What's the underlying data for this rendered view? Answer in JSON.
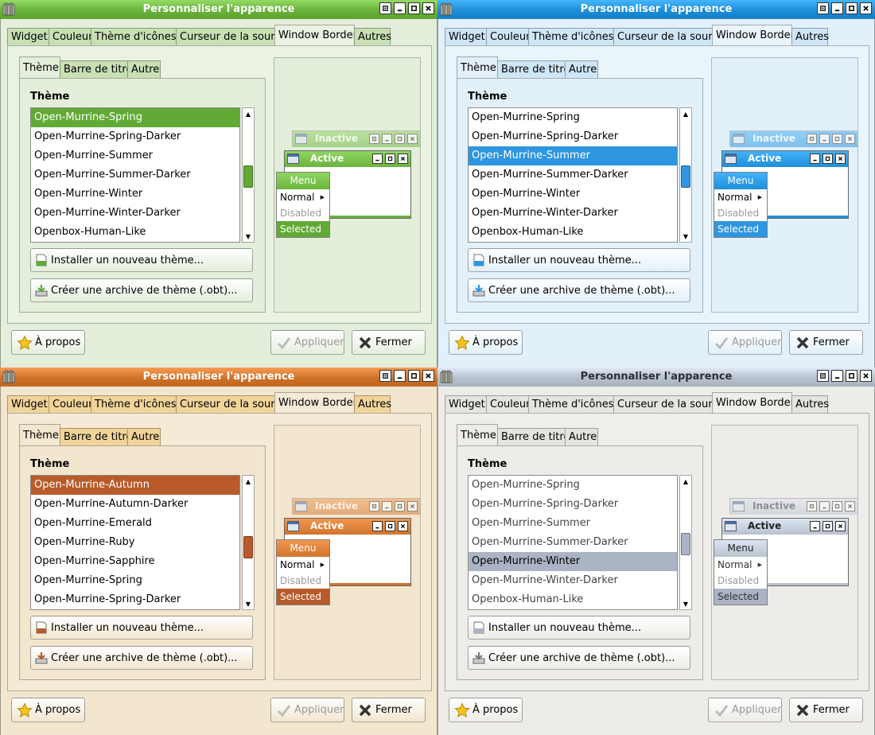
{
  "dialog": {
    "title": "Personnaliser l'apparence",
    "tabs": [
      "Widget",
      "Couleur",
      "Thème d'icônes",
      "Curseur de la souris",
      "Window Border",
      "Autres"
    ],
    "selected_tab": "Window Border",
    "inner_tabs": [
      "Thème",
      "Barre de titre",
      "Autre"
    ],
    "section_label": "Thème",
    "install_button": "Installer un nouveau thème...",
    "archive_button": "Créer une archive de thème (.obt)...",
    "about_button": "À propos",
    "apply_button": "Appliquer",
    "close_button": "Fermer"
  },
  "preview": {
    "inactive_title": "Inactive",
    "active_title": "Active",
    "menu_title": "Menu",
    "menu_items": [
      "Normal",
      "Disabled",
      "Selected"
    ]
  },
  "icons": [
    "app-icon",
    "minimize-icon",
    "maximize-icon",
    "restore-icon",
    "close-icon",
    "install-icon",
    "archive-icon",
    "star-icon",
    "check-icon",
    "x-icon"
  ],
  "windows": [
    {
      "theme": "green",
      "colors": {
        "titlebar": "#6cb33e",
        "bg": "#e3eedb",
        "tab": "#c8e0b4",
        "accent": "#62aa36",
        "panel": "#eaf2e2"
      },
      "list_items": [
        "Open-Murrine-Spring",
        "Open-Murrine-Spring-Darker",
        "Open-Murrine-Summer",
        "Open-Murrine-Summer-Darker",
        "Open-Murrine-Winter",
        "Open-Murrine-Winter-Darker",
        "Openbox-Human-Like"
      ],
      "selected_item": "Open-Murrine-Spring",
      "scroll_position": 0.52
    },
    {
      "theme": "blue",
      "colors": {
        "titlebar": "#1e8fd8",
        "bg": "#e2f0fa",
        "tab": "#cfe6f7",
        "accent": "#2e96e0",
        "panel": "#eaf4fb"
      },
      "list_items": [
        "Open-Murrine-Spring",
        "Open-Murrine-Spring-Darker",
        "Open-Murrine-Summer",
        "Open-Murrine-Summer-Darker",
        "Open-Murrine-Winter",
        "Open-Murrine-Winter-Darker",
        "Openbox-Human-Like"
      ],
      "selected_item": "Open-Murrine-Summer",
      "scroll_position": 0.52
    },
    {
      "theme": "orange",
      "colors": {
        "titlebar": "#d0742c",
        "bg": "#f3e6cf",
        "tab": "#f0d49a",
        "accent": "#b85a2a",
        "panel": "#f5ead6"
      },
      "list_items": [
        "Open-Murrine-Autumn",
        "Open-Murrine-Autumn-Darker",
        "Open-Murrine-Emerald",
        "Open-Murrine-Ruby",
        "Open-Murrine-Sapphire",
        "Open-Murrine-Spring",
        "Open-Murrine-Spring-Darker"
      ],
      "selected_item": "Open-Murrine-Autumn",
      "scroll_position": 0.55
    },
    {
      "theme": "grey",
      "colors": {
        "titlebar": "#b9c2cf",
        "bg": "#eeece8",
        "tab": "#e6e4df",
        "accent": "#aab4c4",
        "panel": "#f0eeea"
      },
      "list_items": [
        "Open-Murrine-Spring",
        "Open-Murrine-Spring-Darker",
        "Open-Murrine-Summer",
        "Open-Murrine-Summer-Darker",
        "Open-Murrine-Winter",
        "Open-Murrine-Winter-Darker",
        "Openbox-Human-Like"
      ],
      "selected_item": "Open-Murrine-Winter",
      "scroll_position": 0.52
    }
  ]
}
